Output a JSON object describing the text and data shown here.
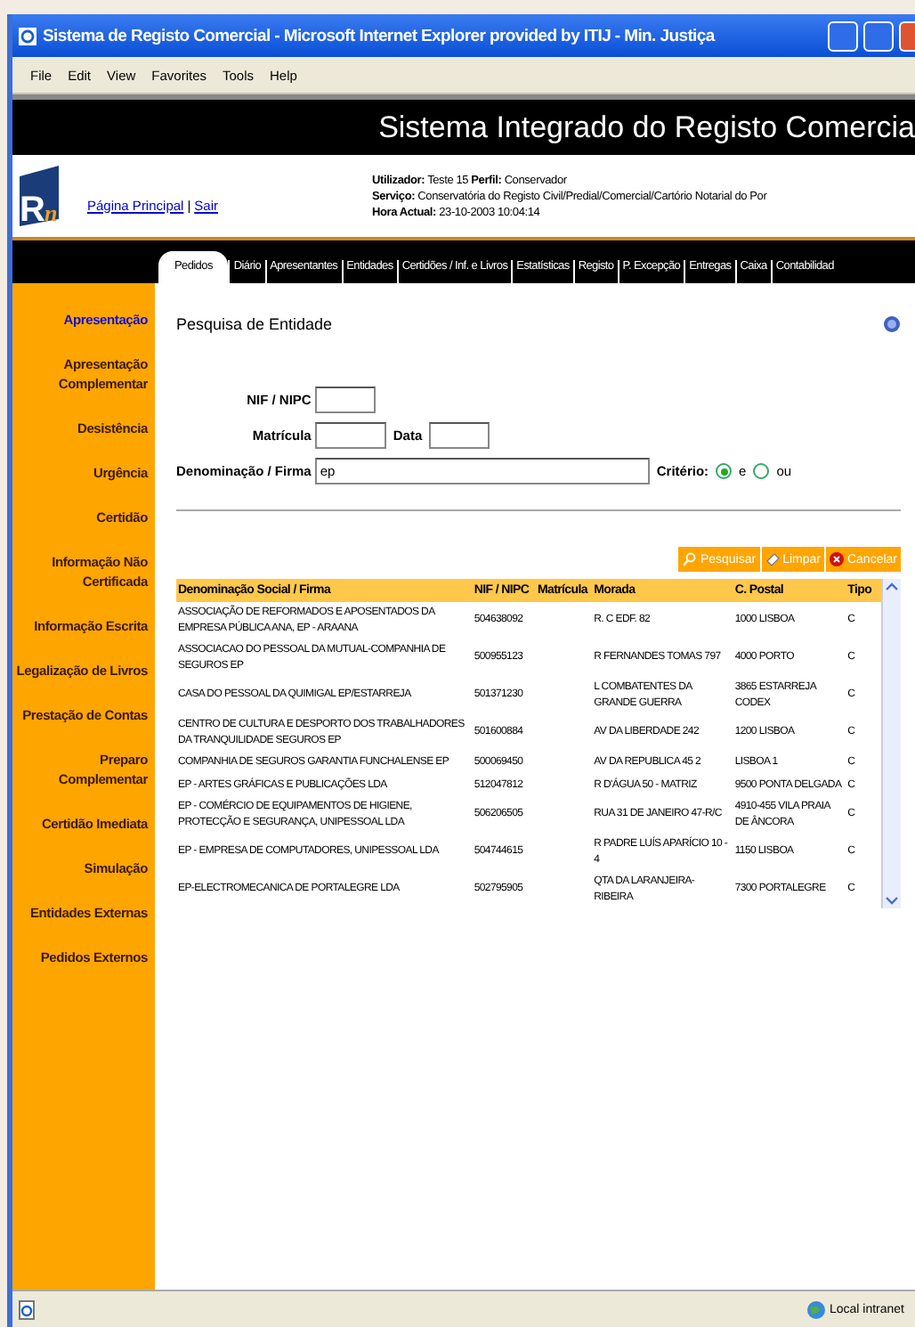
{
  "window": {
    "title": "Sistema de Registo Comercial - Microsoft Internet Explorer provided by ITIJ - Min. Justiça"
  },
  "menu": [
    "File",
    "Edit",
    "View",
    "Favorites",
    "Tools",
    "Help"
  ],
  "header": {
    "title": "Sistema Integrado do Registo Comercia"
  },
  "logo": {
    "letter": "R",
    "accent": "n"
  },
  "links": [
    "Página Principal",
    "Sair"
  ],
  "link_separator": "|",
  "info": [
    {
      "label": "Utilizador:",
      "value": "Teste 15"
    },
    {
      "label": "Perfil:",
      "value": "Conservador"
    }
  ],
  "info_lines": [
    {
      "label": "Serviço:",
      "value": "Conservatória do Registo Civil/Predial/Comercial/Cartório Notarial do Por"
    },
    {
      "label": "Hora Actual:",
      "value": "23-10-2003 10:04:14"
    }
  ],
  "tabs": [
    {
      "label": "Pedidos",
      "selected": true
    },
    {
      "label": "Diário",
      "selected": false
    },
    {
      "label": "Apresentantes",
      "selected": false
    },
    {
      "label": "Entidades",
      "selected": false
    },
    {
      "label": "Certidões / Inf. e Livros",
      "selected": false
    },
    {
      "label": "Estatísticas",
      "selected": false
    },
    {
      "label": "Registo",
      "selected": false
    },
    {
      "label": "P. Excepção",
      "selected": false
    },
    {
      "label": "Entregas",
      "selected": false
    },
    {
      "label": "Caixa",
      "selected": false
    },
    {
      "label": "Contabilidad",
      "selected": false
    }
  ],
  "sidebar": {
    "items": [
      {
        "label": "Apresentação",
        "selected": true
      },
      {
        "label": "Apresentação Complementar",
        "selected": false
      },
      {
        "label": "Desistência",
        "selected": false
      },
      {
        "label": "Urgência",
        "selected": false
      },
      {
        "label": "Certidão",
        "selected": false
      },
      {
        "label": "Informação Não Certificada",
        "selected": false
      },
      {
        "label": "Informação Escrita",
        "selected": false
      },
      {
        "label": "Legalização de Livros",
        "selected": false
      },
      {
        "label": "Prestação de Contas",
        "selected": false
      },
      {
        "label": "Preparo Complementar",
        "selected": false
      },
      {
        "label": "Certidão Imediata",
        "selected": false
      },
      {
        "label": "Simulação",
        "selected": false
      },
      {
        "label": "Entidades Externas",
        "selected": false
      },
      {
        "label": "Pedidos Externos",
        "selected": false
      }
    ]
  },
  "form": {
    "title": "Pesquisa de Entidade",
    "nif_label": "NIF / NIPC",
    "matricula_label": "Matrícula",
    "data_label": "Data",
    "denominacao_label": "Denominação / Firma",
    "denominacao_value": "ep",
    "criterio_label": "Critério:",
    "criterio_options": [
      {
        "label": "e",
        "selected": true
      },
      {
        "label": "ou",
        "selected": false
      }
    ]
  },
  "buttons": [
    {
      "kind": "search",
      "label": "Pesquisar"
    },
    {
      "kind": "clear",
      "label": "Limpar"
    },
    {
      "kind": "cancel",
      "label": "Cancelar"
    }
  ],
  "table": {
    "columns": [
      "Denominação Social / Firma",
      "NIF / NIPC",
      "Matrícula",
      "Morada",
      "C. Postal",
      "Tipo"
    ],
    "rows": [
      [
        "ASSOCIAÇÃO DE REFORMADOS E APOSENTADOS DA EMPRESA PÚBLICA ANA, EP - ARAANA",
        "504638092",
        "",
        "R. C EDF. 82",
        "1000 LISBOA",
        "C"
      ],
      [
        "ASSOCIACAO DO PESSOAL DA MUTUAL-COMPANHIA DE SEGUROS EP",
        "500955123",
        "",
        "R FERNANDES TOMAS 797",
        "4000 PORTO",
        "C"
      ],
      [
        "CASA DO PESSOAL DA QUIMIGAL EP/ESTARREJA",
        "501371230",
        "",
        "L COMBATENTES DA GRANDE GUERRA",
        "3865 ESTARREJA CODEX",
        "C"
      ],
      [
        "CENTRO DE CULTURA E DESPORTO DOS TRABALHADORES DA TRANQUILIDADE SEGUROS EP",
        "501600884",
        "",
        "AV DA LIBERDADE 242",
        "1200 LISBOA",
        "C"
      ],
      [
        "COMPANHIA DE SEGUROS GARANTIA FUNCHALENSE EP",
        "500069450",
        "",
        "AV DA REPUBLICA 45 2",
        "LISBOA 1",
        "C"
      ],
      [
        "EP - ARTES GRÁFICAS E PUBLICAÇÕES LDA",
        "512047812",
        "",
        "R D'ÁGUA 50 - MATRIZ",
        "9500 PONTA DELGADA",
        "C"
      ],
      [
        "EP - COMÉRCIO DE EQUIPAMENTOS DE HIGIENE, PROTECÇÃO E SEGURANÇA, UNIPESSOAL LDA",
        "506206505",
        "",
        "RUA 31 DE JANEIRO 47-R/C",
        "4910-455 VILA PRAIA DE ÂNCORA",
        "C"
      ],
      [
        "EP - EMPRESA DE COMPUTADORES, UNIPESSOAL LDA",
        "504744615",
        "",
        "R PADRE LUÍS APARÍCIO 10 - 4",
        "1150 LISBOA",
        "C"
      ],
      [
        "EP-ELECTROMECANICA DE PORTALEGRE LDA",
        "502795905",
        "",
        "QTA DA LARANJEIRA-RIBEIRA",
        "7300 PORTALEGRE",
        "C"
      ]
    ]
  },
  "status_bar": {
    "zone": "Local intranet"
  }
}
